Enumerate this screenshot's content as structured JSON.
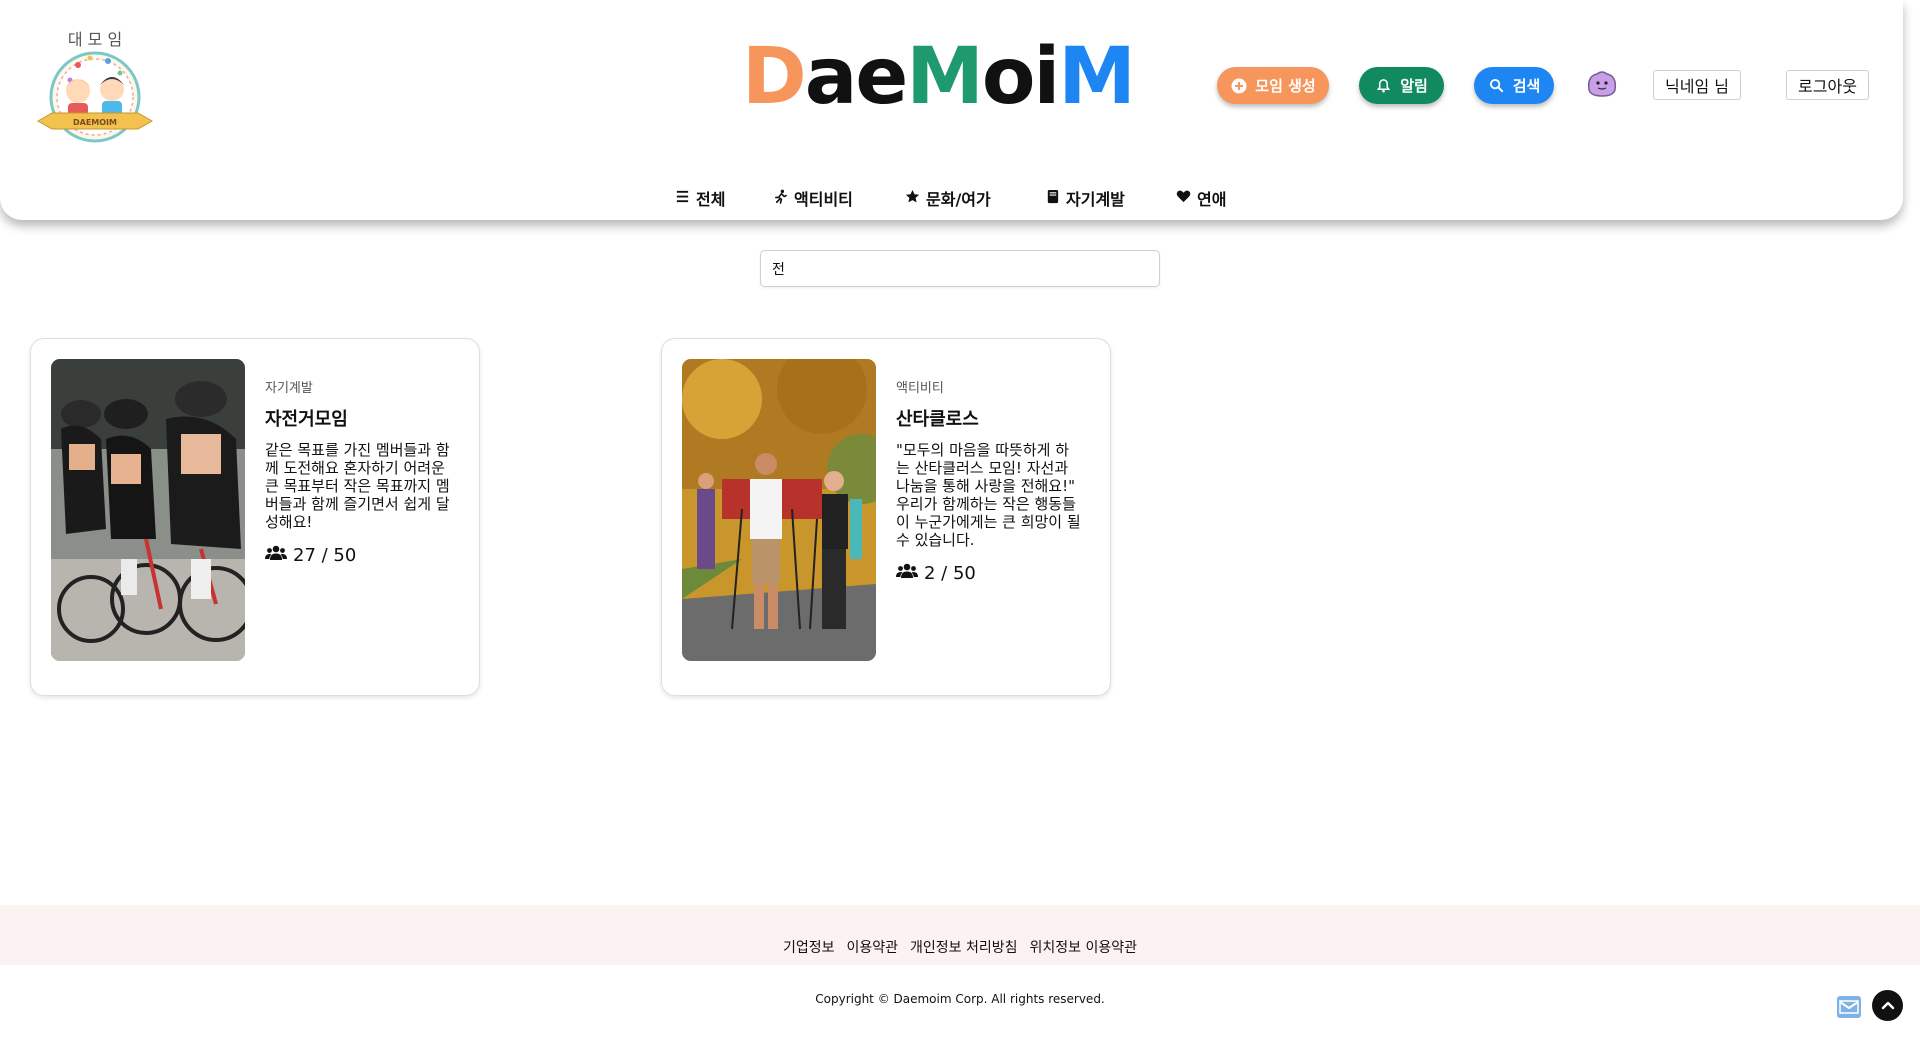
{
  "logo": {
    "emblem_text": "대 모 임",
    "emblem_ribbon": "DAEMOIM",
    "wordmark": "DaeMoiM"
  },
  "header": {
    "create_label": "모임 생성",
    "alarm_label": "알림",
    "search_label": "검색",
    "nickname_label": "닉네임 님",
    "logout_label": "로그아웃",
    "colors": {
      "create": "#f6955c",
      "alarm": "#128a60",
      "search": "#1e86f2"
    }
  },
  "nav": {
    "items": [
      {
        "label": "전체",
        "icon": "list-icon"
      },
      {
        "label": "액티비티",
        "icon": "running-icon"
      },
      {
        "label": "문화/여가",
        "icon": "star-icon"
      },
      {
        "label": "자기계발",
        "icon": "book-icon"
      },
      {
        "label": "연애",
        "icon": "heart-icon"
      }
    ]
  },
  "search": {
    "value": "전"
  },
  "cards": [
    {
      "category": "자기계발",
      "title": "자전거모임",
      "description": "같은 목표를 가진 멤버들과 함께 도전해요 혼자하기 어려운 큰 목표부터 작은 목표까지 멤버들과 함께 즐기면서 쉽게 달성해요!",
      "count": "27 / 50",
      "image": "cyclists-photo"
    },
    {
      "category": "액티비티",
      "title": "산타클로스",
      "description": "\"모두의 마음을 따뜻하게 하는 산타클러스 모임! 자선과 나눔을 통해 사랑을 전해요!\" 우리가 함께하는 작은 행동들이 누군가에게는 큰 희망이 될 수 있습니다.",
      "count": "2 / 50",
      "image": "hikers-photo"
    }
  ],
  "footer": {
    "links": [
      "기업정보",
      "이용약관",
      "개인정보 처리방침",
      "위치정보 이용약관"
    ],
    "copyright": "Copyright © Daemoim Corp. All rights reserved."
  }
}
